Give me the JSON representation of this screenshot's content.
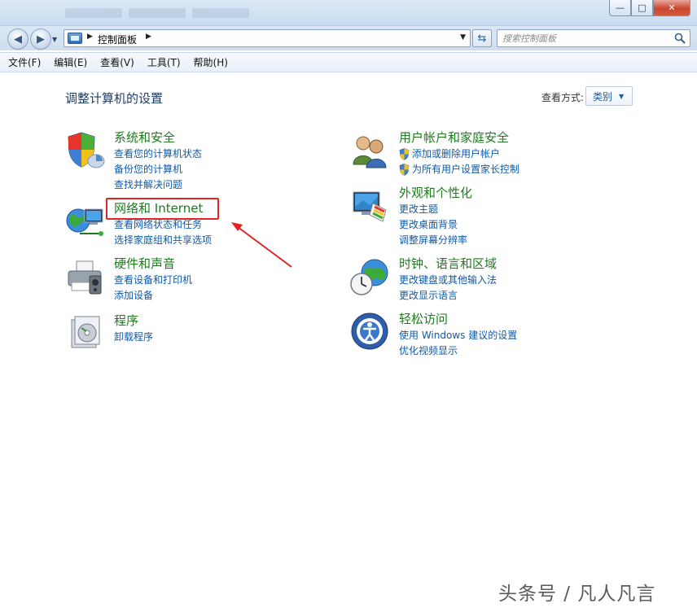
{
  "window": {
    "minimize_glyph": "—",
    "maximize_glyph": "□",
    "close_glyph": "✕"
  },
  "address": {
    "path": "控制面板",
    "search_placeholder": "搜索控制面板"
  },
  "menu": [
    "文件(F)",
    "编辑(E)",
    "查看(V)",
    "工具(T)",
    "帮助(H)"
  ],
  "content": {
    "title": "调整计算机的设置",
    "view_by_label": "查看方式:",
    "view_by_value": "类别"
  },
  "categories": [
    {
      "title": "系统和安全",
      "icon": "shield-icon",
      "links": [
        "查看您的计算机状态",
        "备份您的计算机",
        "查找并解决问题"
      ]
    },
    {
      "title": "网络和 Internet",
      "icon": "globe-network-icon",
      "links": [
        "查看网络状态和任务",
        "选择家庭组和共享选项"
      ]
    },
    {
      "title": "硬件和声音",
      "icon": "printer-icon",
      "links": [
        "查看设备和打印机",
        "添加设备"
      ]
    },
    {
      "title": "程序",
      "icon": "programs-icon",
      "links": [
        "卸载程序"
      ]
    },
    {
      "title": "用户帐户和家庭安全",
      "icon": "users-icon",
      "links": [
        "添加或删除用户帐户",
        "为所有用户设置家长控制"
      ]
    },
    {
      "title": "外观和个性化",
      "icon": "display-icon",
      "links": [
        "更改主题",
        "更改桌面背景",
        "调整屏幕分辨率"
      ]
    },
    {
      "title": "时钟、语言和区域",
      "icon": "clock-globe-icon",
      "links": [
        "更改键盘或其他输入法",
        "更改显示语言"
      ]
    },
    {
      "title": "轻松访问",
      "icon": "ease-of-access-icon",
      "links": [
        "使用 Windows 建议的设置",
        "优化视频显示"
      ]
    }
  ],
  "watermark": "头条号 / 凡人凡言",
  "colors": {
    "category_title": "#1f7a1f",
    "link": "#0f5aa8",
    "highlight": "#e32323"
  }
}
